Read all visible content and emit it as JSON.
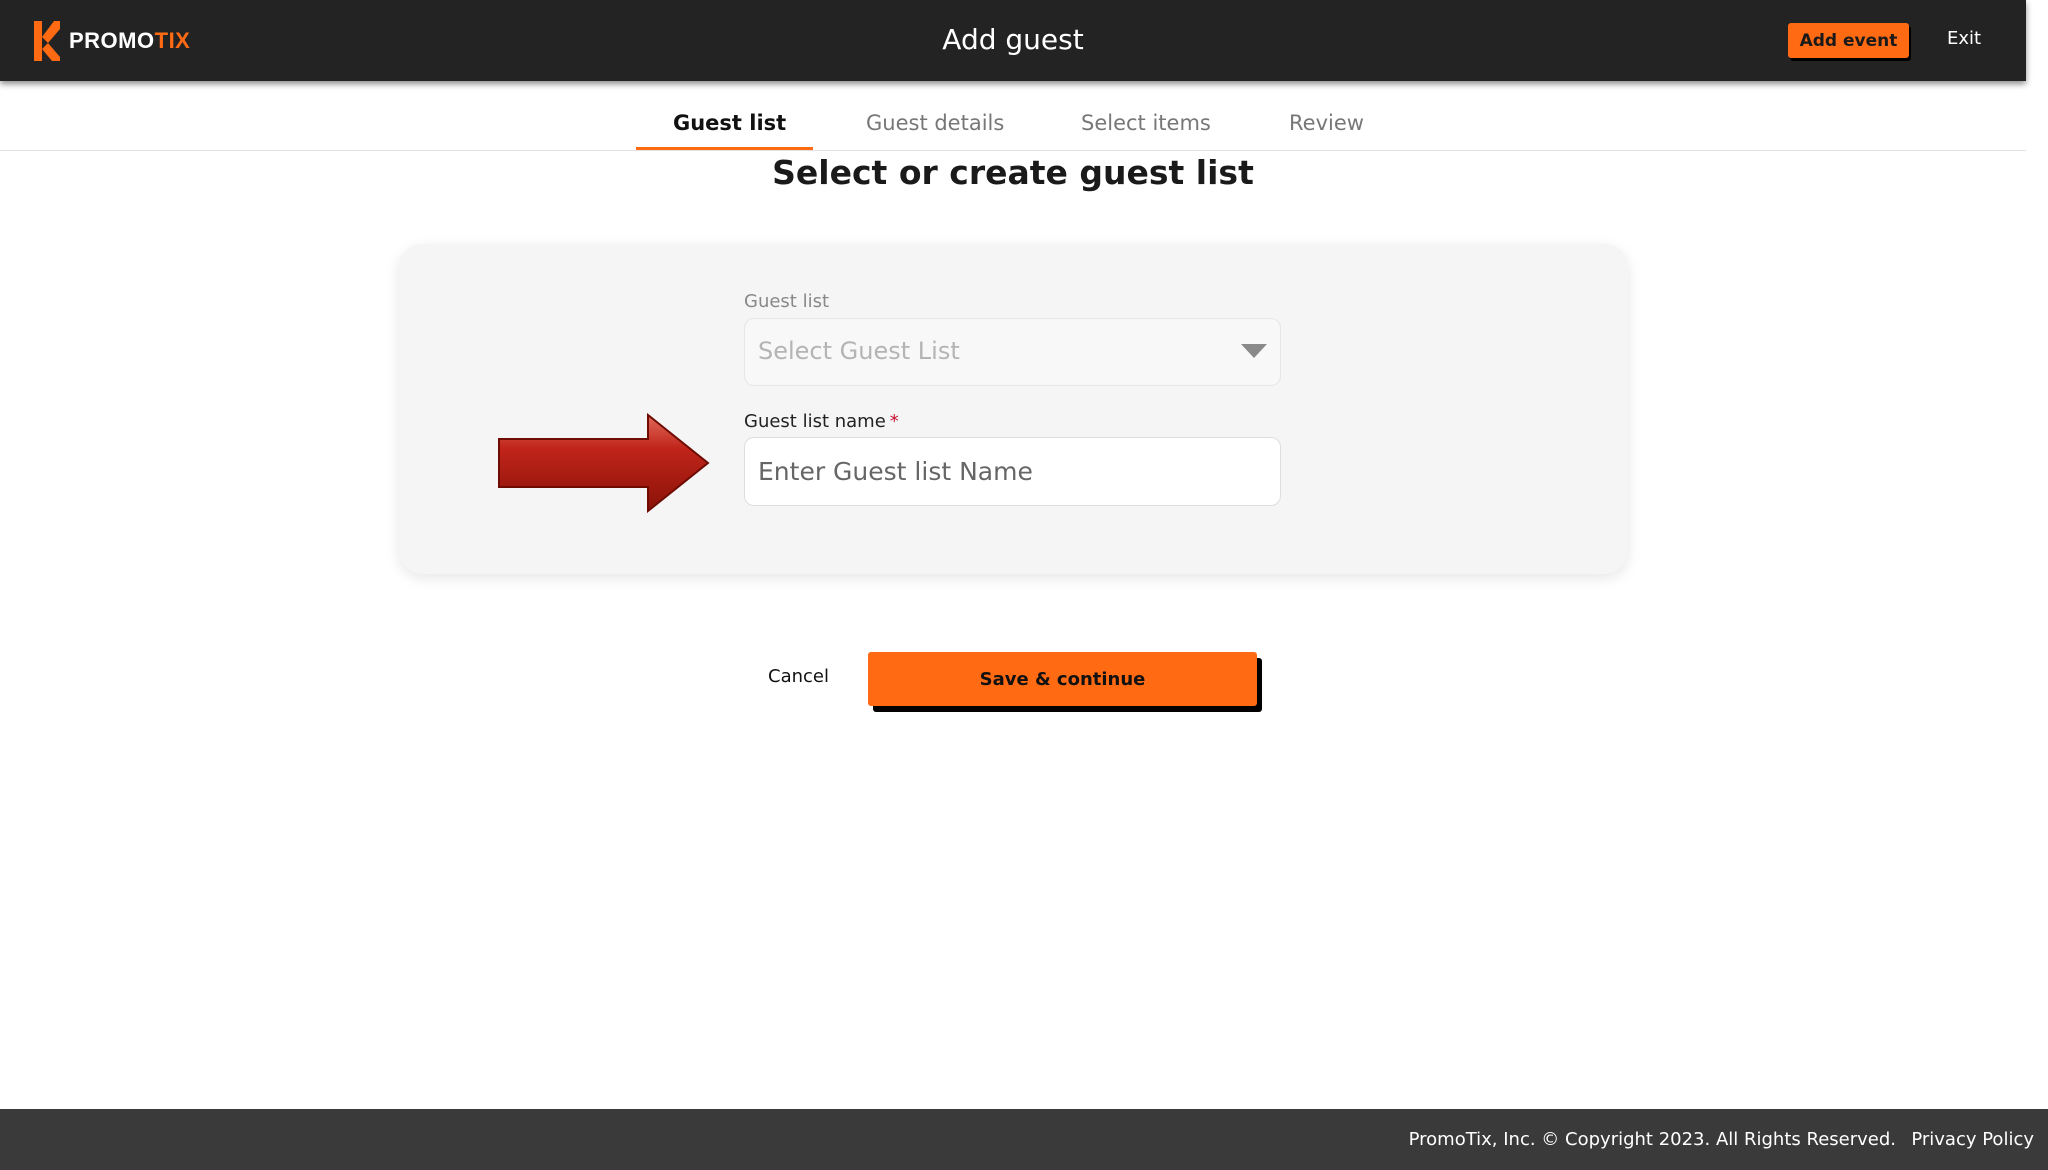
{
  "header": {
    "brand_primary": "PROMO",
    "brand_accent": "TIX",
    "title": "Add guest",
    "add_event_label": "Add event",
    "exit_label": "Exit"
  },
  "tabs": [
    {
      "label": "Guest list",
      "active": true
    },
    {
      "label": "Guest details",
      "active": false
    },
    {
      "label": "Select items",
      "active": false
    },
    {
      "label": "Review",
      "active": false
    }
  ],
  "section": {
    "title_bold": "Select or create",
    "title_regular": " guest list"
  },
  "form": {
    "guest_list_label": "Guest list",
    "guest_list_placeholder": "Select Guest List",
    "guest_list_name_label": "Guest list name",
    "required_marker": "*",
    "guest_list_name_placeholder": "Enter Guest list Name",
    "guest_list_name_value": ""
  },
  "actions": {
    "cancel_label": "Cancel",
    "save_label": "Save & continue"
  },
  "footer": {
    "copyright": "PromoTix, Inc. © Copyright 2023. All Rights Reserved.",
    "privacy_label": "Privacy Policy"
  },
  "colors": {
    "accent": "#ff6a13",
    "header_bg": "#232323",
    "footer_bg": "#3a3a3a",
    "arrow": "#b81a10"
  },
  "icons": {
    "logo": "promotix-logo-icon",
    "dropdown": "caret-down-icon",
    "annotation": "red-arrow-icon"
  }
}
